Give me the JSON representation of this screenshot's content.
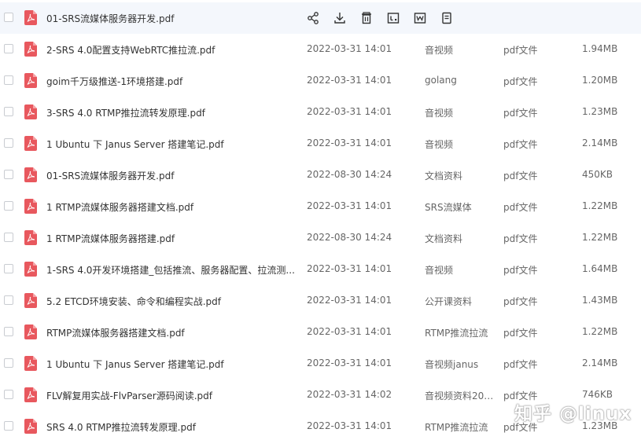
{
  "colors": {
    "pdf_icon": "#e8585e",
    "hover_row": "#f4f7fc",
    "text_primary": "#333333",
    "text_secondary": "#666666"
  },
  "row_actions": [
    {
      "name": "share-icon"
    },
    {
      "name": "download-icon"
    },
    {
      "name": "delete-icon"
    },
    {
      "name": "rename-icon"
    },
    {
      "name": "open-with-icon"
    },
    {
      "name": "more-icon"
    }
  ],
  "files": [
    {
      "name": "01-SRS流媒体服务器开发.pdf",
      "date": "",
      "folder": "",
      "type": "",
      "size": ""
    },
    {
      "name": "2-SRS 4.0配置支持WebRTC推拉流.pdf",
      "date": "2022-03-31 14:01",
      "folder": "音视频",
      "type": "pdf文件",
      "size": "1.94MB"
    },
    {
      "name": "goim千万级推送-1环境搭建.pdf",
      "date": "2022-03-31 14:01",
      "folder": "golang",
      "type": "pdf文件",
      "size": "1.20MB"
    },
    {
      "name": "3-SRS 4.0 RTMP推拉流转发原理.pdf",
      "date": "2022-03-31 14:01",
      "folder": "音视频",
      "type": "pdf文件",
      "size": "1.23MB"
    },
    {
      "name": "1 Ubuntu 下 Janus Server 搭建笔记.pdf",
      "date": "2022-03-31 14:01",
      "folder": "音视频",
      "type": "pdf文件",
      "size": "2.14MB"
    },
    {
      "name": "01-SRS流媒体服务器开发.pdf",
      "date": "2022-08-30 14:24",
      "folder": "文档资料",
      "type": "pdf文件",
      "size": "450KB"
    },
    {
      "name": "1 RTMP流媒体服务器搭建文档.pdf",
      "date": "2022-03-31 14:01",
      "folder": "SRS流媒体",
      "type": "pdf文件",
      "size": "1.22MB"
    },
    {
      "name": "1 RTMP流媒体服务器搭建.pdf",
      "date": "2022-08-30 14:24",
      "folder": "文档资料",
      "type": "pdf文件",
      "size": "1.22MB"
    },
    {
      "name": "1-SRS 4.0开发环境搭建_包括推流、服务器配置、拉流测...",
      "date": "2022-03-31 14:01",
      "folder": "音视频",
      "type": "pdf文件",
      "size": "1.64MB"
    },
    {
      "name": "5.2 ETCD环境安装、命令和编程实战.pdf",
      "date": "2022-03-31 14:01",
      "folder": "公开课资料",
      "type": "pdf文件",
      "size": "1.43MB"
    },
    {
      "name": "RTMP流媒体服务器搭建文档.pdf",
      "date": "2022-03-31 14:01",
      "folder": "RTMP推流拉流",
      "type": "pdf文件",
      "size": "1.22MB"
    },
    {
      "name": "1 Ubuntu 下 Janus Server 搭建笔记.pdf",
      "date": "2022-03-31 14:01",
      "folder": "音视频janus",
      "type": "pdf文件",
      "size": "2.14MB"
    },
    {
      "name": "FLV解复用实战-FlvParser源码阅读.pdf",
      "date": "2022-03-31 14:02",
      "folder": "音视频资料202...",
      "type": "pdf文件",
      "size": "746KB"
    },
    {
      "name": "SRS 4.0 RTMP推拉流转发原理.pdf",
      "date": "2022-03-31 14:01",
      "folder": "RTMP推流拉流",
      "type": "pdf文件",
      "size": "1.23MB"
    }
  ],
  "watermark": "知乎 @linux"
}
